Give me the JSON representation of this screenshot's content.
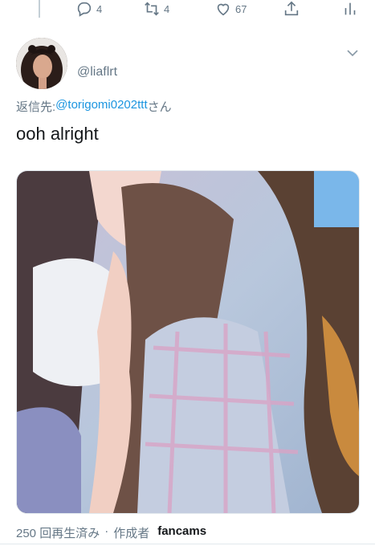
{
  "colors": {
    "accent": "#1b95e0",
    "secondary": "#657786",
    "text": "#14171a"
  },
  "actions": {
    "reply": {
      "icon": "reply-icon",
      "count": "4"
    },
    "retweet": {
      "icon": "retweet-icon",
      "count": "4"
    },
    "like": {
      "icon": "heart-icon",
      "count": "67"
    },
    "share": {
      "icon": "share-icon"
    },
    "analytics": {
      "icon": "analytics-icon"
    }
  },
  "tweet": {
    "username": "@liaflrt",
    "reply_prefix": "返信先: ",
    "reply_handle": "@torigomi0202ttt",
    "reply_suffix": "さん",
    "text": "ooh alright"
  },
  "media_meta": {
    "views": "250 回再生済み",
    "separator": "·",
    "creator_label": "作成者",
    "source": "fancams"
  }
}
